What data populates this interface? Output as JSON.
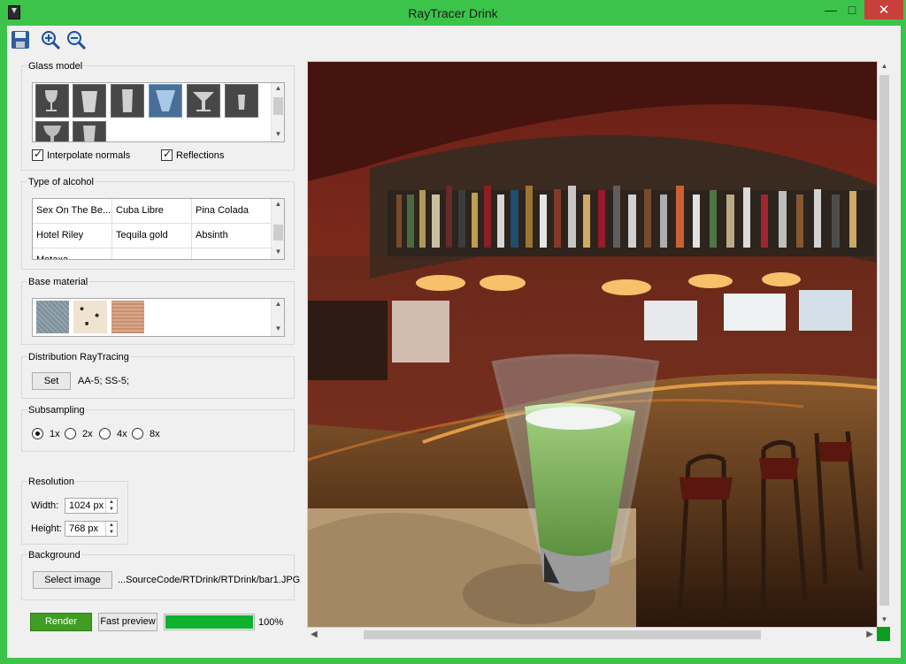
{
  "window": {
    "title": "RayTracer Drink",
    "close_symbol": "✕",
    "minimize_symbol": "—",
    "maximize_symbol": "□"
  },
  "toolbar": {
    "icons": [
      "save-icon",
      "zoom-in-icon",
      "zoom-out-icon"
    ]
  },
  "glass_model": {
    "title": "Glass model",
    "models": [
      {
        "icon": "wine-glass-icon",
        "selected": false
      },
      {
        "icon": "tumbler-glass-icon",
        "selected": false
      },
      {
        "icon": "tall-glass-icon",
        "selected": false
      },
      {
        "icon": "shot-glass-icon",
        "selected": true
      },
      {
        "icon": "martini-glass-icon",
        "selected": false
      },
      {
        "icon": "small-glass-icon",
        "selected": false
      },
      {
        "icon": "goblet-icon",
        "selected": false
      },
      {
        "icon": "short-glass-icon",
        "selected": false
      }
    ],
    "interpolate_normals": {
      "label": "Interpolate normals",
      "checked": true
    },
    "reflections": {
      "label": "Reflections",
      "checked": true
    }
  },
  "alcohol": {
    "title": "Type of alcohol",
    "rows": [
      [
        "Sex On The Be...",
        "Cuba Libre",
        "Pina Colada"
      ],
      [
        "Hotel Riley",
        "Tequila gold",
        "Absinth"
      ],
      [
        "Metaxa",
        "",
        ""
      ]
    ]
  },
  "base_material": {
    "title": "Base material",
    "materials": [
      "blue-grey-texture",
      "stone-pattern-texture",
      "terracotta-texture"
    ]
  },
  "distribution": {
    "title": "Distribution RayTracing",
    "set_label": "Set",
    "info": "AA-5;  SS-5;"
  },
  "subsampling": {
    "title": "Subsampling",
    "options": [
      {
        "label": "1x",
        "checked": true
      },
      {
        "label": "2x",
        "checked": false
      },
      {
        "label": "4x",
        "checked": false
      },
      {
        "label": "8x",
        "checked": false
      }
    ]
  },
  "resolution": {
    "title": "Resolution",
    "width_label": "Width:",
    "width_value": "1024 px",
    "height_label": "Height:",
    "height_value": "768 px"
  },
  "background": {
    "title": "Background",
    "select_label": "Select image",
    "path": "...SourceCode/RTDrink/RTDrink/bar1.JPG"
  },
  "actions": {
    "render_label": "Render",
    "fast_preview_label": "Fast preview",
    "progress_text": "100%",
    "progress_fraction": 1.0
  },
  "viewer": {
    "scene": "bar-scene-with-green-drink"
  },
  "colors": {
    "accent": "#3cc34a",
    "render_button": "#3f9d24",
    "progress": "#0fb12e"
  }
}
